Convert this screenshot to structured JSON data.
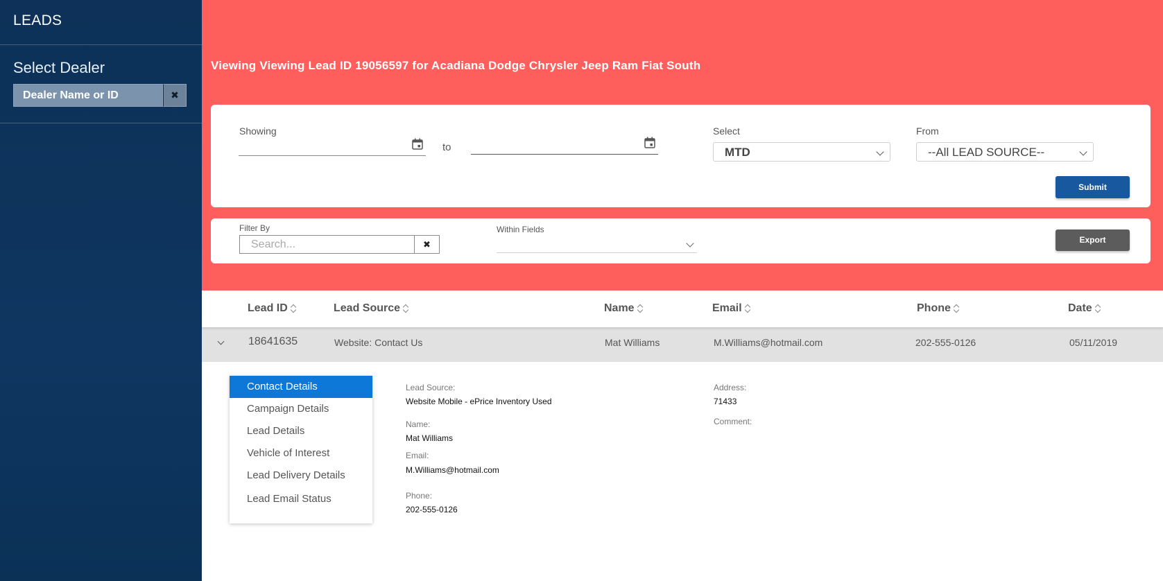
{
  "sidebar": {
    "brand": "LEADS",
    "dealer_title": "Select Dealer",
    "dealer_placeholder": "Dealer Name or ID"
  },
  "header": {
    "title": "Viewing Viewing Lead ID 19056597 for Acadiana Dodge Chrysler Jeep Ram Fiat South"
  },
  "filters": {
    "showing_label": "Showing",
    "to_label": "to",
    "start_date": "",
    "end_date": "",
    "select_label": "Select",
    "select_value": "MTD",
    "from_label": "From",
    "from_value": "--All LEAD SOURCE--",
    "submit_label": "Submit"
  },
  "search": {
    "filter_label": "Filter By",
    "placeholder": "Search...",
    "within_label": "Within Fields",
    "within_value": "",
    "export_label": "Export"
  },
  "table": {
    "columns": [
      "Lead ID",
      "Lead Source",
      "Name",
      "Email",
      "Phone",
      "Date"
    ],
    "rows": [
      {
        "lead_id": "18641635",
        "lead_source": "Website: Contact Us",
        "name": "Mat Williams",
        "email": "M.Williams@hotmail.com",
        "phone": "202-555-0126",
        "date": "05/11/2019"
      }
    ]
  },
  "detail": {
    "menu": [
      "Contact Details",
      "Campaign Details",
      "Lead Details",
      "Vehicle of Interest",
      "Lead Delivery Details",
      "Lead Email Status"
    ],
    "active_menu": "Contact Details",
    "lead_source_label": "Lead Source:",
    "lead_source_value": "Website Mobile - ePrice Inventory Used",
    "name_label": "Name:",
    "name_value": "Mat Williams",
    "email_label": "Email:",
    "email_value": "M.Williams@hotmail.com",
    "phone_label": "Phone:",
    "phone_value": "202-555-0126",
    "address_label": "Address:",
    "address_value": "71433",
    "comment_label": "Comment:",
    "comment_value": ""
  },
  "colors": {
    "sidebar_bg": "#0d3158",
    "header_bg": "#fe5f5d",
    "submit_bg": "#17589e",
    "export_bg": "#5c5c5c",
    "active_menu_bg": "#0e78d8"
  }
}
